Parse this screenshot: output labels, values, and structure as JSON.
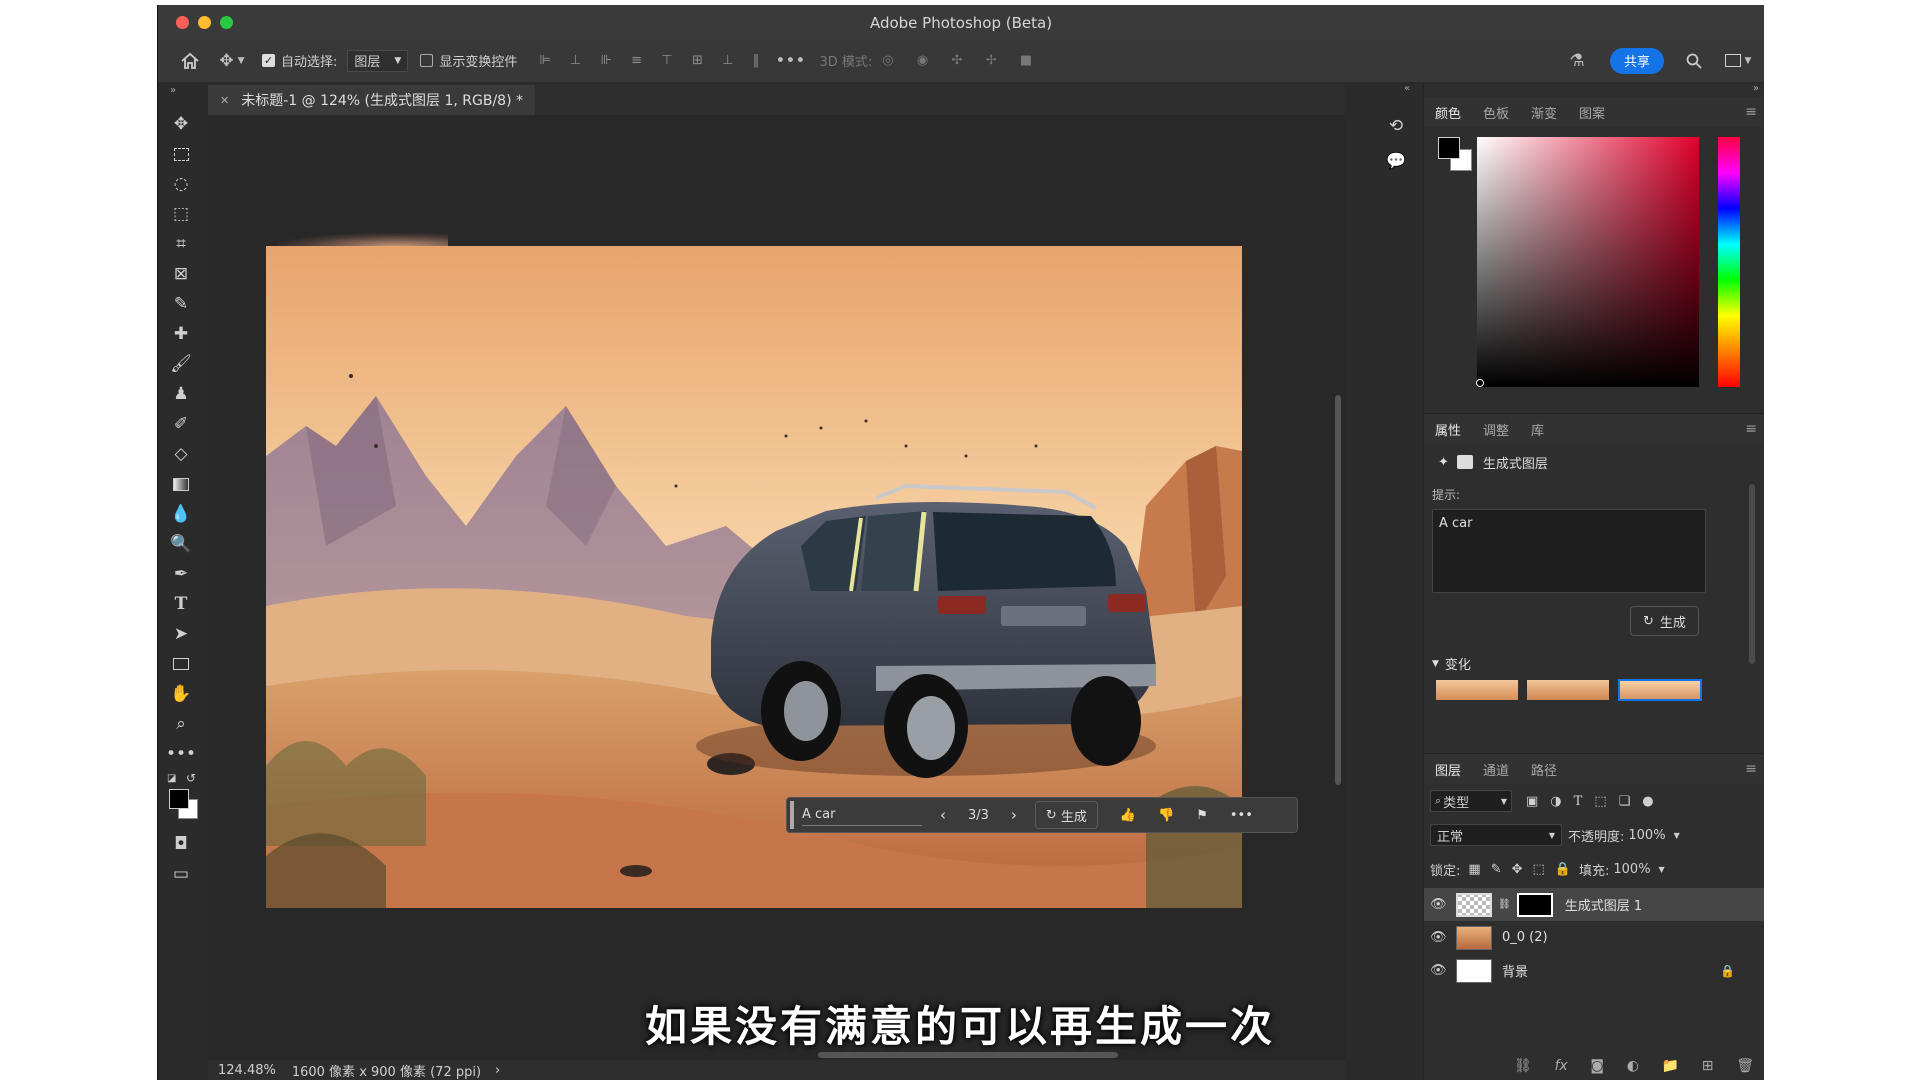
{
  "window": {
    "title": "Adobe Photoshop (Beta)"
  },
  "optionsbar": {
    "auto_select_label": "自动选择:",
    "auto_select_value": "图层",
    "show_transform_label": "显示变换控件",
    "mode_3d_label": "3D 模式:",
    "share_label": "共享"
  },
  "document": {
    "tab_title": "未标题-1 @ 124% (生成式图层 1, RGB/8) *"
  },
  "canvas_toolbar": {
    "prompt_value": "A car",
    "counter": "3/3",
    "generate_label": "生成"
  },
  "subtitle": "如果没有满意的可以再生成一次",
  "status": {
    "zoom": "124.48%",
    "doc_info": "1600 像素 x 900 像素 (72 ppi)"
  },
  "color_panel": {
    "tabs": [
      "颜色",
      "色板",
      "渐变",
      "图案"
    ]
  },
  "properties_panel": {
    "tabs": [
      "属性",
      "调整",
      "库"
    ],
    "layer_type": "生成式图层",
    "prompt_label": "提示:",
    "prompt_value": "A car",
    "generate_label": "生成",
    "variations_label": "变化"
  },
  "layers_panel": {
    "tabs": [
      "图层",
      "通道",
      "路径"
    ],
    "filter_label": "类型",
    "blend_mode": "正常",
    "opacity_label": "不透明度:",
    "opacity_value": "100%",
    "lock_label": "锁定:",
    "fill_label": "填充:",
    "fill_value": "100%",
    "layers": [
      {
        "name": "生成式图层 1"
      },
      {
        "name": "0_0 (2)"
      },
      {
        "name": "背景"
      }
    ]
  },
  "colors": {
    "accent": "#1473e6",
    "foreground": "#000000",
    "background": "#ffffff"
  }
}
